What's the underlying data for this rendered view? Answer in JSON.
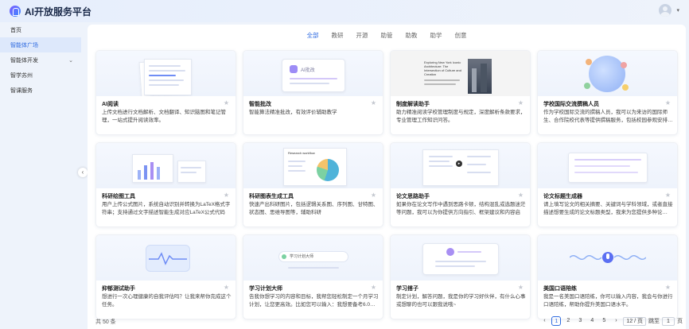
{
  "app": {
    "title": "AI开放服务平台"
  },
  "sidebar": {
    "items": [
      {
        "label": "首页",
        "active": false,
        "has_arrow": false
      },
      {
        "label": "智能体广场",
        "active": true,
        "has_arrow": false
      },
      {
        "label": "智能体开发",
        "active": false,
        "has_arrow": true
      },
      {
        "label": "智学苏州",
        "active": false,
        "has_arrow": false
      },
      {
        "label": "智课服务",
        "active": false,
        "has_arrow": false
      }
    ]
  },
  "tabs": [
    {
      "label": "全部",
      "active": true
    },
    {
      "label": "教研",
      "active": false
    },
    {
      "label": "开源",
      "active": false
    },
    {
      "label": "助管",
      "active": false
    },
    {
      "label": "助教",
      "active": false
    },
    {
      "label": "助学",
      "active": false
    },
    {
      "label": "创意",
      "active": false
    }
  ],
  "cards": [
    {
      "title": "AI阅读",
      "desc": "上传文档进行文档解析、文档翻译、知识脑图和笔记管理，一站式提升阅读效率。"
    },
    {
      "title": "智能批改",
      "desc": "智能算法精准批改，有效评价辅助教学"
    },
    {
      "title": "制度解读助手",
      "desc": "助力精准阅读学校管理制度与规定，深度解析条款要求，专业管理工作知识问答。"
    },
    {
      "title": "学校国际交流撰稿人员",
      "desc": "作为学校国际交流的撰稿人员，我可以为来访的国际师生、合作院校代表等提供撰稿服务，包括校园参观安排…"
    },
    {
      "title": "科研绘图工具",
      "desc": "用户上传公式图片，系统自动识别并转换为LaTeX格式字符串；支持通过文字描述智能生成对应LaTeX公式代码"
    },
    {
      "title": "科研图表生成工具",
      "desc": "快速产出科研图片，包括逻辑关系图、序列图、甘特图、状态图、思维导图等，辅助科研"
    },
    {
      "title": "论文思路助手",
      "desc": "如果你在论文写作中遇到思路卡顿，结构混乱或选题迷茫等问题，我可以为你提供方向指引、框架建议和内容启发…"
    },
    {
      "title": "论文标题生成器",
      "desc": "请上填写论文的相关摘要、关键词与学科领域，或者直接描述想要生成的论文标题类型，我来为您提供多种论…"
    },
    {
      "title": "抑郁测试助手",
      "desc": "想进行一次心理健康的自我评估吗？让我来帮你完成这个任务。"
    },
    {
      "title": "学习计划大师",
      "desc": "告我你想学习的内容和目标，我帮您轻松制定一个月学习计划，让您更高效。比如您可以输入：我想要备考6.0…"
    },
    {
      "title": "学习搭子",
      "desc": "制定计划，解答问题，我是你的学习好伙伴，有什么心事或想聊的也可以跟我说哦~"
    },
    {
      "title": "美国口语陪练",
      "desc": "我是一名美国口语陪练，你可以输入内容，我会与你进行口语陪练，帮助你提升美国口语水平。"
    }
  ],
  "thumb_texts": {
    "t2_label": "AI批改",
    "t3_heading": "Exploring New York Iconic Architecture: The Intersection of Culture and Creation",
    "t6_heading": "Research workflow",
    "t10_label": "学习计划大师"
  },
  "footer": {
    "total": "共 50 条"
  },
  "pagination": {
    "prev": "‹",
    "pages": [
      "1",
      "2",
      "3",
      "4",
      "5"
    ],
    "current": "1",
    "next": "›",
    "page_size": "12 / 页",
    "jump_label": "跳至",
    "jump_value": "1",
    "jump_suffix": "页"
  },
  "colors": {
    "accent": "#2f6be0",
    "active_bg": "#dde8fb"
  }
}
